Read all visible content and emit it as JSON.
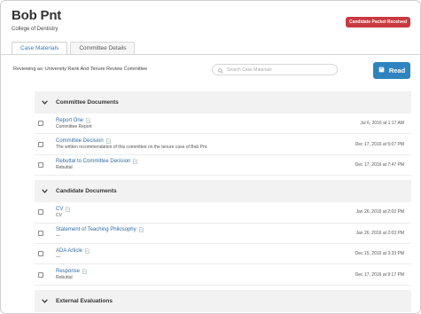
{
  "candidate": {
    "name": "Bob Pnt",
    "college": "College of Dentistry"
  },
  "badge": "Candidate Packet Received",
  "tabs": [
    {
      "label": "Case Materials",
      "active": true
    },
    {
      "label": "Committee Details",
      "active": false
    }
  ],
  "reviewing": "Reviewing as: University Rank And Tenure Review Committee",
  "search": {
    "placeholder": "Search Case Materials"
  },
  "read_button": "Read",
  "sections": [
    {
      "title": "Committee Documents",
      "items": [
        {
          "title": "Report One",
          "desc": "Committee Report",
          "date": "Jul 6, 2016 at 1:17 AM"
        },
        {
          "title": "Committee Decision",
          "desc": "The written recommendation of this committee on the tenure case of Bob Pnt.",
          "date": "Dec 17, 2016 at 5:07 PM"
        },
        {
          "title": "Rebuttal to Committee Decision",
          "desc": "Rebuttal",
          "date": "Dec 17, 2016 at 7:47 PM"
        }
      ]
    },
    {
      "title": "Candidate Documents",
      "items": [
        {
          "title": "CV",
          "desc": "CV",
          "date": "Jan 26, 2016 at 2:02 PM"
        },
        {
          "title": "Statement of Teaching Philosophy",
          "desc": "—",
          "date": "Jan 26, 2016 at 2:03 PM"
        },
        {
          "title": "ADA Article",
          "desc": "—",
          "date": "Dec 15, 2016 at 3:33 PM"
        },
        {
          "title": "Response",
          "desc": "Rebuttal",
          "date": "Dec 17, 2016 at 9:17 PM"
        }
      ]
    },
    {
      "title": "External Evaluations",
      "items": []
    }
  ]
}
